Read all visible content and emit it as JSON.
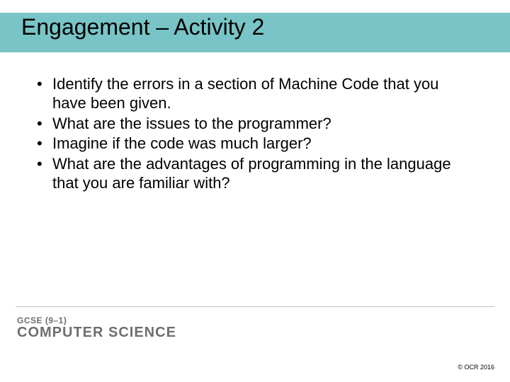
{
  "title": "Engagement – Activity 2",
  "bullets": [
    "Identify the errors in a section of Machine Code that you have been given.",
    "What are the issues to the programmer?",
    "Imagine if the code was much larger?",
    "What are the advantages of programming in the language that you are familiar with?"
  ],
  "footer": {
    "line1": "GCSE (9–1)",
    "line2": "COMPUTER SCIENCE",
    "copyright": "© OCR 2016"
  }
}
